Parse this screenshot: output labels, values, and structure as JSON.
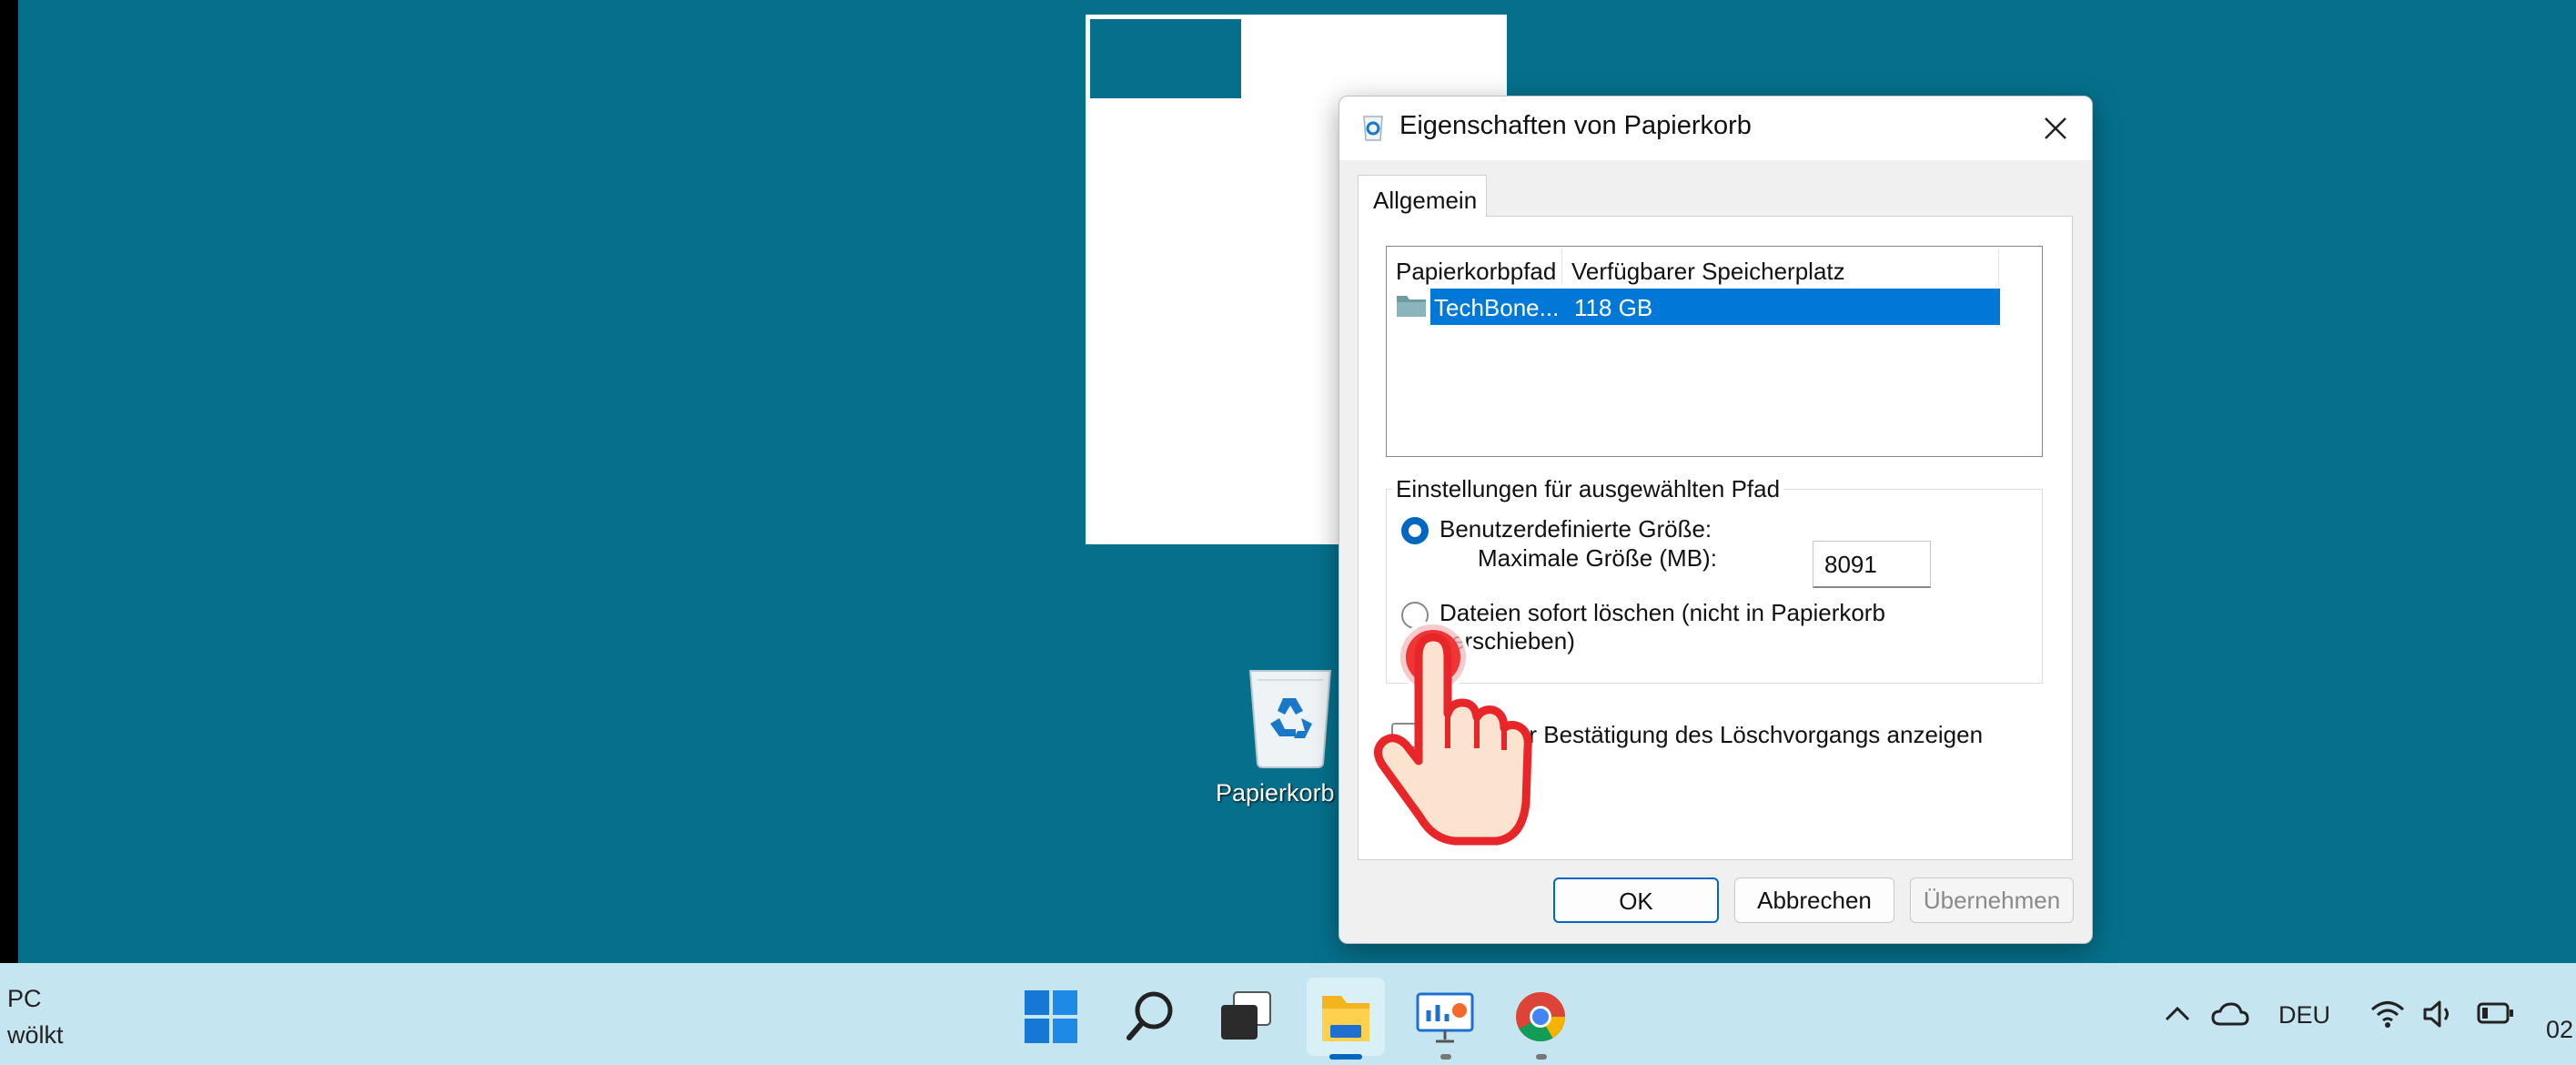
{
  "desktop": {
    "recycle_bin_label": "Papierkorb"
  },
  "dialog": {
    "title": "Eigenschaften von Papierkorb",
    "tab": "Allgemein",
    "list": {
      "columns": [
        "Papierkorbpfad",
        "Verfügbarer Speicherplatz"
      ],
      "rows": [
        {
          "path": "TechBone...",
          "space": "118 GB",
          "selected": true
        }
      ]
    },
    "settings_group": {
      "legend": "Einstellungen für ausgewählten Pfad",
      "custom_size_label": "Benutzerdefinierte Größe:",
      "max_size_label": "Maximale Größe (MB):",
      "max_size_value": "8091",
      "delete_immediately_line1": "Dateien sofort löschen (nicht in Papierkorb",
      "delete_immediately_line2": "verschieben)",
      "selected_option": "custom"
    },
    "confirm_label": "Dialog zur Bestätigung des Löschvorgangs anzeigen",
    "buttons": {
      "ok": "OK",
      "cancel": "Abbrechen",
      "apply": "Übernehmen"
    }
  },
  "taskbar": {
    "weather_line1": "PC",
    "weather_line2": "wölkt",
    "language": "DEU",
    "clock": "02"
  },
  "colors": {
    "desktop": "#06708c",
    "accent": "#0067c0",
    "selection": "#0078d7",
    "taskbar": "#c5e6f0"
  }
}
